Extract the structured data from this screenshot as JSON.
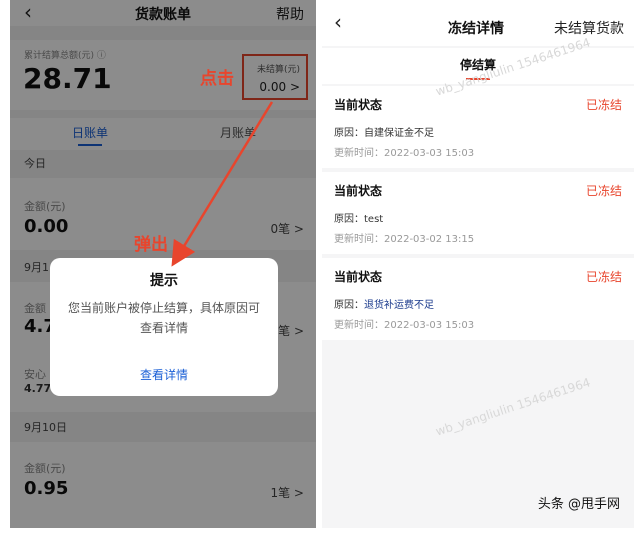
{
  "left": {
    "nav": {
      "back": "‹",
      "title": "货款账单",
      "help": "帮助"
    },
    "summary": {
      "label": "累计结算总额(元) ⓘ",
      "amount": "28.71",
      "unsettled_label": "未结算(元)",
      "unsettled_value": "0.00 >"
    },
    "annotation_click": "点击",
    "annotation_popup": "弹出",
    "tabs": {
      "day": "日账单",
      "month": "月账单"
    },
    "sections": [
      {
        "date": "今日",
        "rows": [
          {
            "label": "金额(元)",
            "amount": "0.00",
            "count": "0笔 >"
          }
        ]
      },
      {
        "date": "9月1",
        "rows": [
          {
            "label": "金额",
            "amount": "4.7",
            "count": "笔 >"
          },
          {
            "label": "安心",
            "amount": "4.77",
            "count": ""
          }
        ]
      },
      {
        "date": "9月10日",
        "rows": [
          {
            "label": "金额(元)",
            "amount": "0.95",
            "count": "1笔 >"
          }
        ]
      }
    ],
    "modal": {
      "title": "提示",
      "message": "您当前账户被停止结算，具体原因可查看详情",
      "link": "查看详情"
    }
  },
  "right": {
    "nav": {
      "back": "‹",
      "title": "冻结详情",
      "right": "未结算货款"
    },
    "tab": "停结算",
    "cards": [
      {
        "label": "当前状态",
        "status": "已冻结",
        "reason_prefix": "原因：",
        "reason": "自建保证金不足",
        "time": "更新时间：2022-03-03 15:03"
      },
      {
        "label": "当前状态",
        "status": "已冻结",
        "reason_prefix": "原因：",
        "reason": "test",
        "time": "更新时间：2022-03-02 13:15"
      },
      {
        "label": "当前状态",
        "status": "已冻结",
        "reason_prefix": "原因：",
        "reason": "退货补运费不足",
        "time": "更新时间：2022-03-03 15:03"
      }
    ],
    "watermark": "wb_yangliulin 1546461964"
  },
  "credit": "头条 @甩手网",
  "colors": {
    "accent_red": "#e8452d",
    "link_blue": "#1a5fd6"
  }
}
